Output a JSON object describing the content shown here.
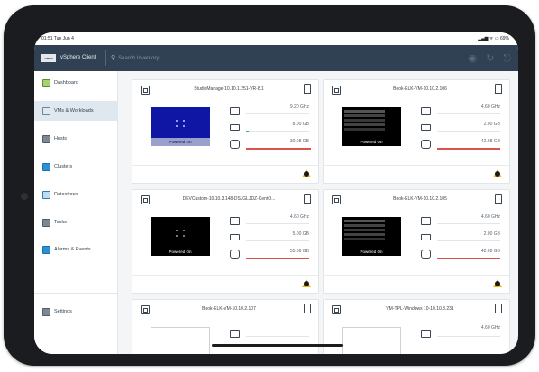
{
  "status_bar": {
    "time": "01:51  Tue Jun 4",
    "indicators": "▂▄▆ ᯤ ▭ 69%"
  },
  "header": {
    "logo_text": "vmw",
    "app_title": "vSphere Client",
    "search_placeholder": "Search Inventory",
    "icons": [
      "help-icon",
      "refresh-icon",
      "user-icon"
    ]
  },
  "sidebar": {
    "items": [
      {
        "label": "Dashboard",
        "icon": "dashboard-icon",
        "active": false
      },
      {
        "label": "VMs & Workloads",
        "icon": "vm-icon",
        "active": true
      },
      {
        "label": "Hosts",
        "icon": "host-icon",
        "active": false
      },
      {
        "label": "Clusters",
        "icon": "cluster-icon",
        "active": false
      },
      {
        "label": "Datastores",
        "icon": "datastore-icon",
        "active": false
      },
      {
        "label": "Tasks",
        "icon": "tasks-icon",
        "active": false
      },
      {
        "label": "Alarms & Events",
        "icon": "alarm-icon",
        "active": false
      },
      {
        "label": "Settings",
        "icon": "settings-icon",
        "active": false
      }
    ]
  },
  "vms": [
    {
      "name": "StudioManage-10.10.1.251-VR-8.1",
      "status": "Powered On",
      "cpu": "9.20 GHz",
      "memory": "8.00 GB",
      "storage": "30.08 GB"
    },
    {
      "name": "Book-ELK-VM-10.10.2.106",
      "status": "Powered On",
      "cpu": "4.60 GHz",
      "memory": "2.00 GB",
      "storage": "42.08 GB"
    },
    {
      "name": "DEVCustom-10.10.3.148-DSJGLJDZ-CentO...",
      "status": "Powered On",
      "cpu": "4.60 GHz",
      "memory": "5.00 GB",
      "storage": "55.08 GB"
    },
    {
      "name": "Book-ELK-VM-10.10.2.105",
      "status": "Powered On",
      "cpu": "4.60 GHz",
      "memory": "2.00 GB",
      "storage": "42.08 GB"
    },
    {
      "name": "Book-ELK-VM-10.10.2.107",
      "status": "",
      "cpu": "",
      "memory": "",
      "storage": ""
    },
    {
      "name": "VM-TPL-Windows 10-10.10.3.231",
      "status": "",
      "cpu": "4.60 GHz",
      "memory": "",
      "storage": ""
    }
  ],
  "colors": {
    "header": "#2f4153",
    "storage_bar": "#d9534f",
    "memory_bar": "#4caf50",
    "active_nav": "#dfe8ef"
  }
}
